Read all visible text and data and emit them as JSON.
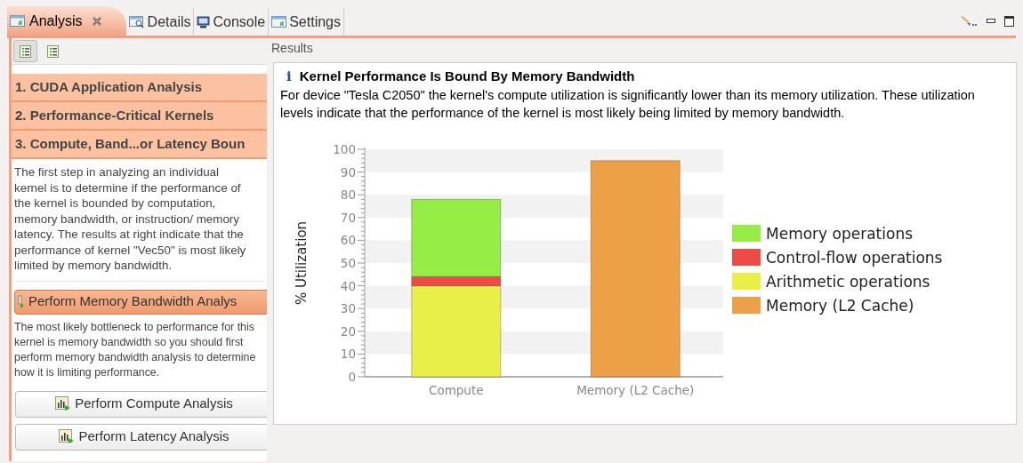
{
  "tabs": [
    {
      "label": "Analysis",
      "selected": true,
      "kind": "chart"
    },
    {
      "label": "Details",
      "selected": false,
      "kind": "magnifier"
    },
    {
      "label": "Console",
      "selected": false,
      "kind": "monitor"
    },
    {
      "label": "Settings",
      "selected": false,
      "kind": "chart"
    }
  ],
  "view_toolbar": [
    {
      "selected": true
    },
    {
      "selected": false
    }
  ],
  "sections": [
    {
      "label": "1. CUDA Application Analysis"
    },
    {
      "label": "2. Performance-Critical Kernels"
    },
    {
      "label": "3. Compute, Band...or Latency Boun"
    }
  ],
  "description": "The first step in analyzing an individual kernel is to determine if the performance of the kernel is bounded by computation, memory bandwidth, or instruction/ memory latency.  The results at right indicate that the performance of kernel \"Vec50\" is most likely limited by memory bandwidth.",
  "primary_action": "Perform Memory Bandwidth Analys",
  "recommendation": "The most likely bottleneck to performance for this kernel is memory bandwidth so you should first perform memory bandwidth analysis to determine how it is limiting performance.",
  "other_actions": [
    "Perform Compute Analysis",
    "Perform Latency Analysis"
  ],
  "results": {
    "group_label": "Results",
    "title": "Kernel Performance Is Bound By Memory Bandwidth",
    "info_icon": "i",
    "message": "For device \"Tesla C2050\" the kernel's compute utilization is significantly lower than its memory utilization. These utilization levels indicate that the performance of the kernel is most likely being limited by memory bandwidth.",
    "chart_data": {
      "type": "bar",
      "stacked": true,
      "legend": "right",
      "ylabel": "% Utilization",
      "categories": [
        "Compute",
        "Memory (L2 Cache)"
      ],
      "ylim": [
        0,
        100
      ],
      "yticks": [
        0,
        10,
        20,
        30,
        40,
        50,
        60,
        70,
        80,
        90,
        100
      ],
      "series": [
        {
          "name": "Memory operations",
          "color": "#95ed45",
          "values": [
            34,
            null
          ]
        },
        {
          "name": "Control-flow operations",
          "color": "#ee4b47",
          "values": [
            4,
            null
          ]
        },
        {
          "name": "Arithmetic operations",
          "color": "#e8ef46",
          "values": [
            40,
            null
          ]
        },
        {
          "name": "Memory (L2 Cache)",
          "color": "#eea047",
          "values": [
            null,
            95
          ]
        }
      ]
    }
  }
}
